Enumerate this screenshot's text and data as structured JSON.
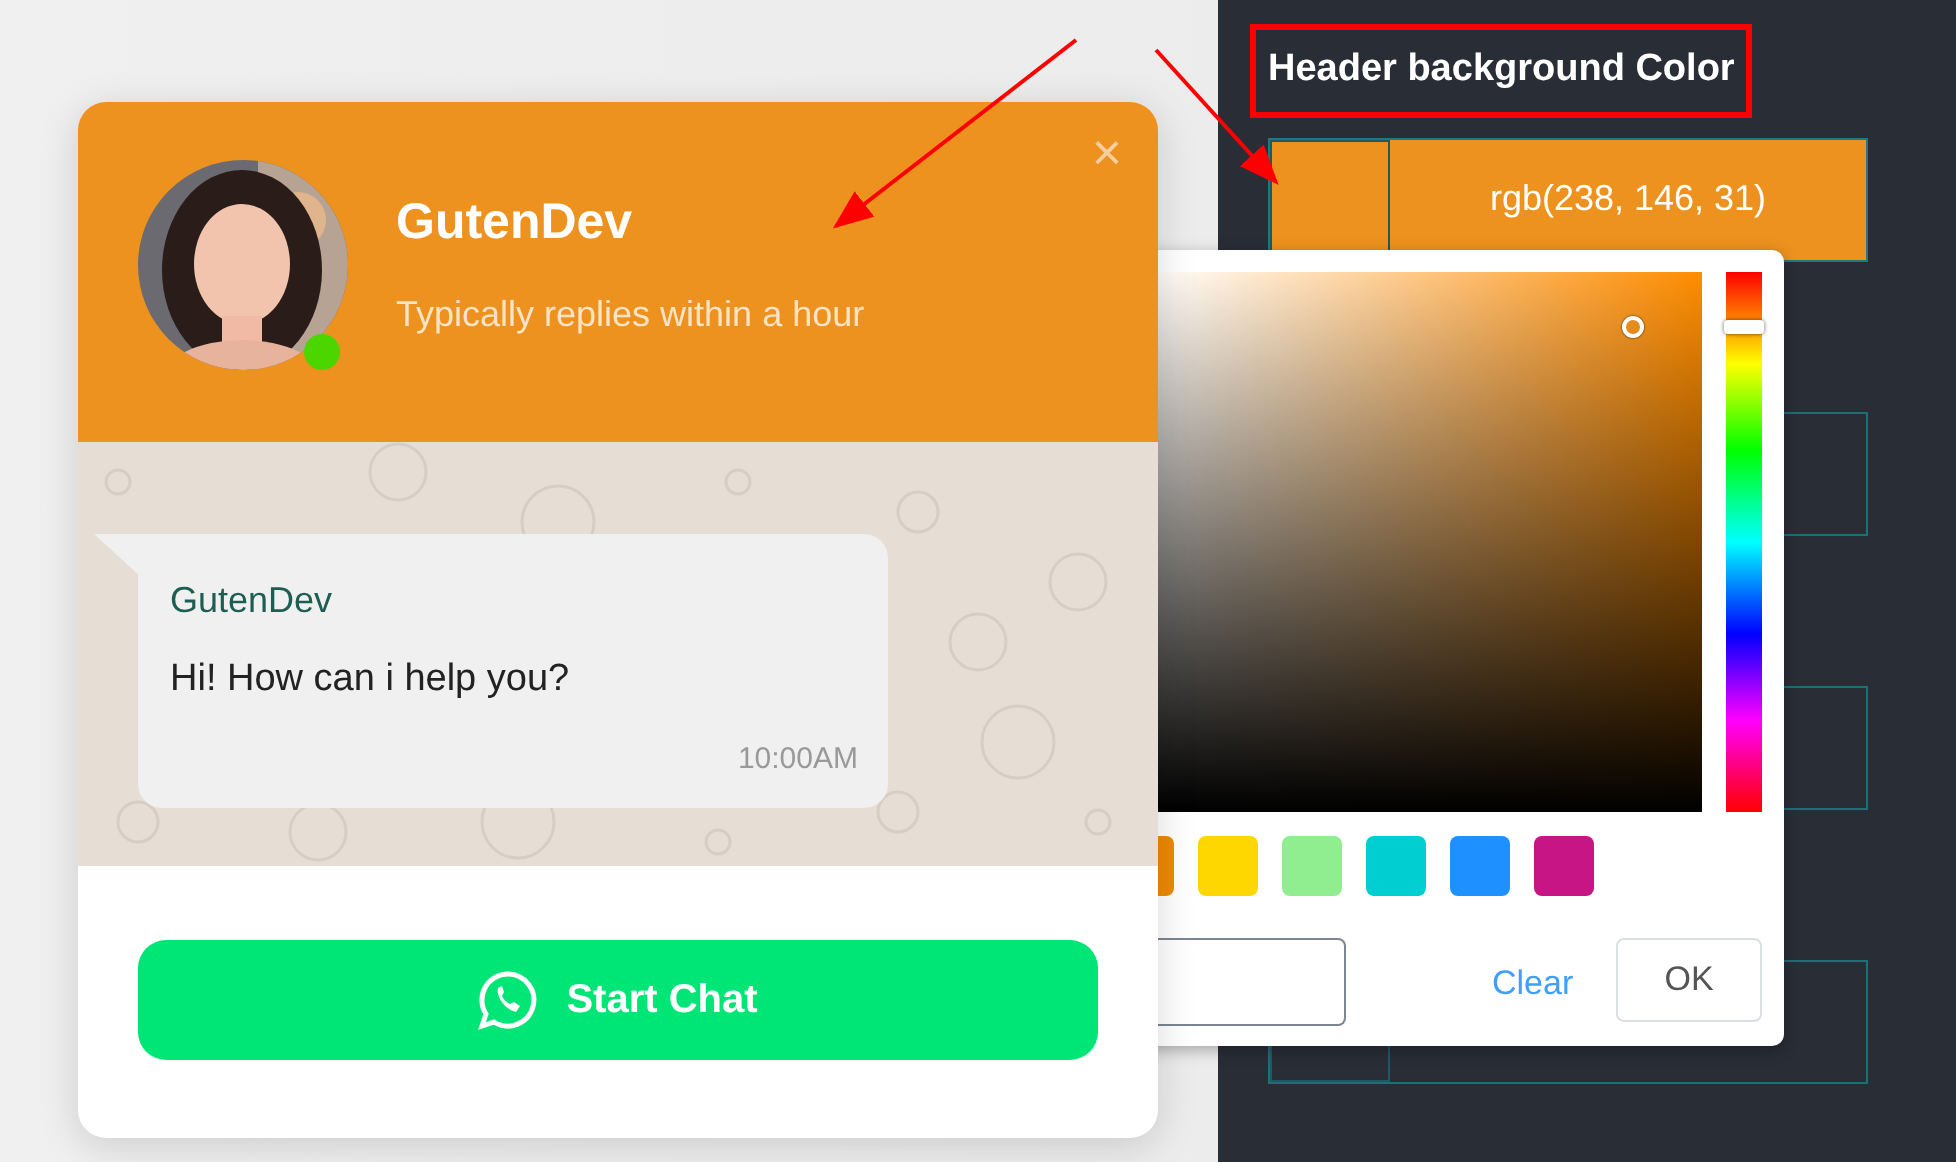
{
  "settings_panel": {
    "label": "Header background Color",
    "color_value": "rgb(238, 146, 31)",
    "color": "#ee921f"
  },
  "color_picker": {
    "swatches": [
      {
        "color": "#ee8a00"
      },
      {
        "color": "#ffd700"
      },
      {
        "color": "#90ee90"
      },
      {
        "color": "#00ced1"
      },
      {
        "color": "#1e90ff"
      },
      {
        "color": "#c71585"
      }
    ],
    "clear": "Clear",
    "ok": "OK"
  },
  "chat_widget": {
    "close": "×",
    "name": "GutenDev",
    "status": "Typically replies within a hour",
    "online": true,
    "message": {
      "sender": "GutenDev",
      "text": "Hi! How can i help you?",
      "time": "10:00AM"
    },
    "button": "Start Chat"
  }
}
